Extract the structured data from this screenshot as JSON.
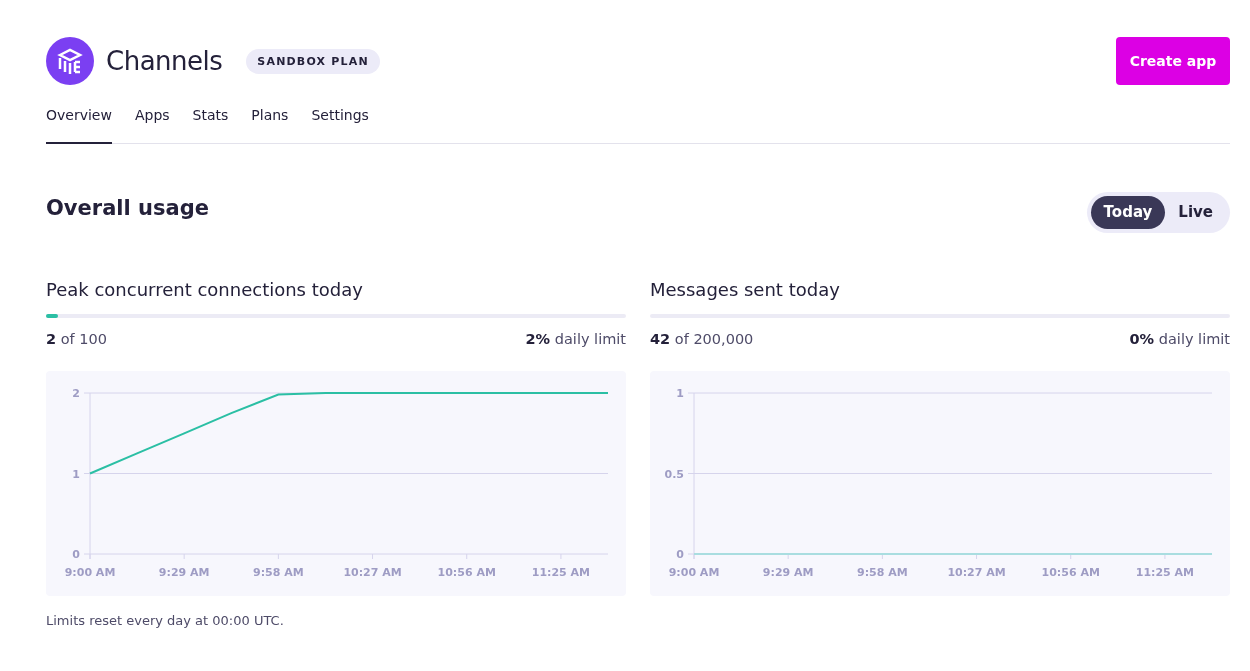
{
  "header": {
    "title": "Channels",
    "plan_badge": "SANDBOX PLAN",
    "create_button": "Create app"
  },
  "tabs": [
    {
      "label": "Overview",
      "selected": true
    },
    {
      "label": "Apps",
      "selected": false
    },
    {
      "label": "Stats",
      "selected": false
    },
    {
      "label": "Plans",
      "selected": false
    },
    {
      "label": "Settings",
      "selected": false
    }
  ],
  "section": {
    "title": "Overall usage",
    "toggle": [
      {
        "label": "Today",
        "selected": true
      },
      {
        "label": "Live",
        "selected": false
      }
    ]
  },
  "panels": [
    {
      "title": "Peak concurrent connections today",
      "level": 0.02,
      "count": "**2** of 100",
      "limit": "**2%** daily limit",
      "chart_data": {
        "type": "line",
        "categories": [
          "9:00 AM",
          null,
          "9:29 AM",
          null,
          "9:58 AM",
          null,
          "10:27 AM",
          null,
          "10:56 AM",
          null,
          "11:25 AM",
          null
        ],
        "series": [
          {
            "color": "#2bbfa4",
            "values": [
              1,
              1.25,
              1.5,
              1.75,
              1.98,
              2,
              2,
              2,
              2,
              2,
              2,
              2
            ]
          }
        ],
        "ylim": [
          0,
          2
        ],
        "yticks": [
          0,
          1,
          2
        ]
      }
    },
    {
      "title": "Messages sent today",
      "count": "**42** of 200,000",
      "limit": "**0%** daily limit",
      "chart_data": {
        "type": "line",
        "categories": [
          "9:00 AM",
          null,
          "9:29 AM",
          null,
          "9:58 AM",
          null,
          "10:27 AM",
          null,
          "10:56 AM",
          null,
          "11:25 AM",
          null
        ],
        "series": [
          {
            "color": "#a9dde0",
            "values": [
              0,
              0,
              0,
              0,
              0,
              0,
              0,
              0,
              0,
              0,
              0,
              0
            ]
          }
        ],
        "ylim": [
          0,
          1
        ],
        "yticks": [
          0,
          0.5,
          1
        ]
      }
    }
  ],
  "footer_note": "Limits reset every day at 00:00 UTC."
}
